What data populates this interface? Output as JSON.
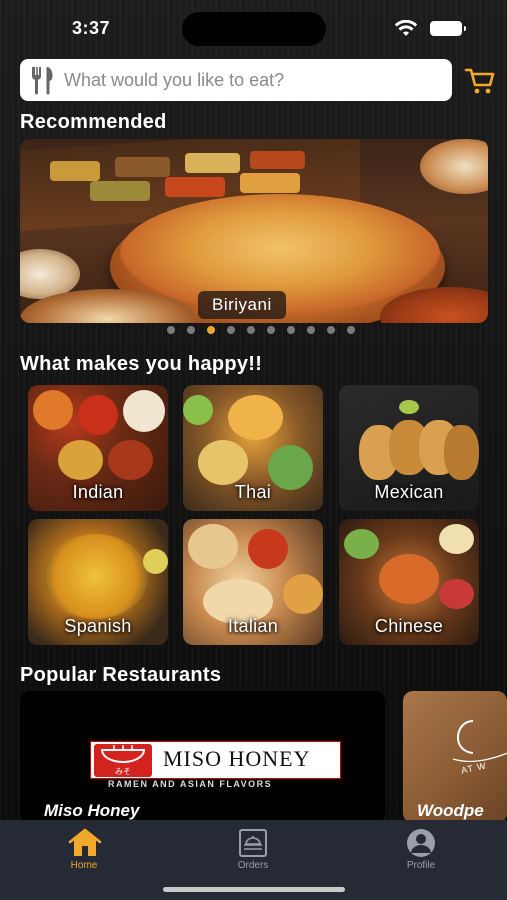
{
  "status_bar": {
    "time": "3:37"
  },
  "search": {
    "placeholder": "What would you like to eat?"
  },
  "recommended": {
    "title": "Recommended",
    "banner_label": "Biriyani",
    "dot_count": 10,
    "active_dot": 2
  },
  "happy": {
    "title": "What makes you happy!!",
    "categories": [
      "Indian",
      "Thai",
      "Mexican",
      "Spanish",
      "Italian",
      "Chinese"
    ]
  },
  "restaurants": {
    "title": "Popular Restaurants",
    "items": [
      {
        "name": "Miso Honey",
        "logo_text": "MISO HONEY",
        "logo_mark": "みそ",
        "tagline": "RAMEN AND ASIAN FLAVORS"
      },
      {
        "name": "Woodpe",
        "logo_text": "AT W"
      }
    ]
  },
  "tabs": [
    {
      "label": "Home",
      "icon": "home-icon",
      "active": true
    },
    {
      "label": "Orders",
      "icon": "orders-icon",
      "active": false
    },
    {
      "label": "Profile",
      "icon": "profile-icon",
      "active": false
    }
  ],
  "colors": {
    "accent": "#f2a92b",
    "tabbar": "#252a35",
    "background": "#141414"
  }
}
